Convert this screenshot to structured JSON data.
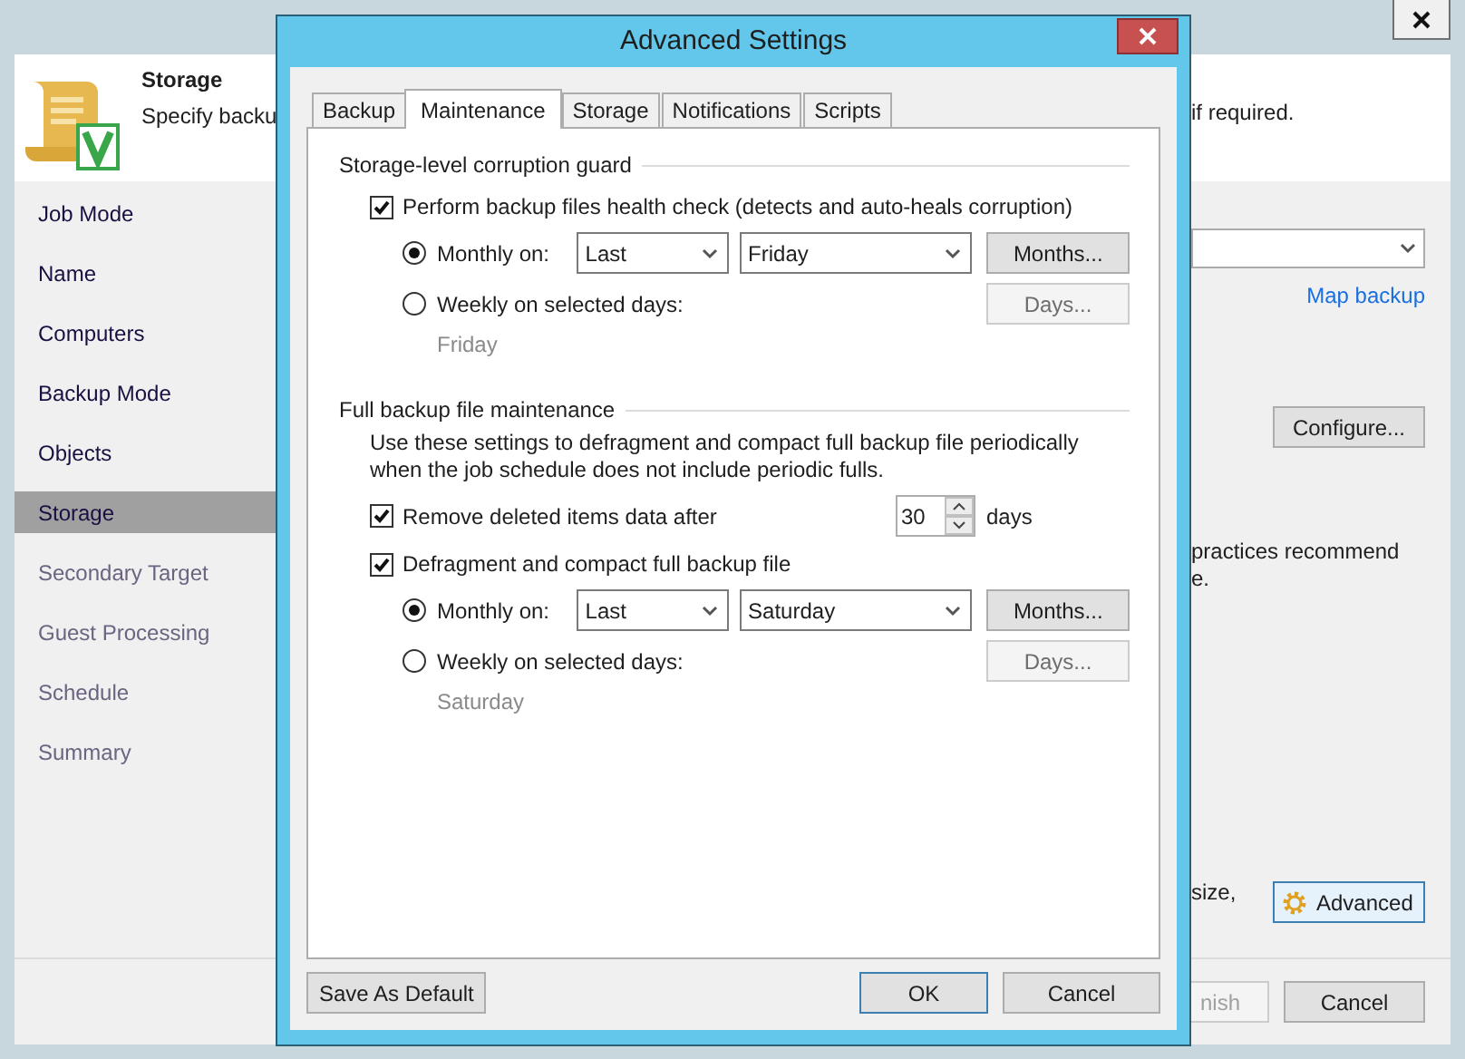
{
  "wizard": {
    "header": {
      "title": "Storage",
      "description_start": "Specify backu",
      "description_end": "if required."
    },
    "steps": [
      {
        "label": "Job Mode",
        "selected": false,
        "disabled": false
      },
      {
        "label": "Name",
        "selected": false,
        "disabled": false
      },
      {
        "label": "Computers",
        "selected": false,
        "disabled": false
      },
      {
        "label": "Backup Mode",
        "selected": false,
        "disabled": false
      },
      {
        "label": "Objects",
        "selected": false,
        "disabled": false
      },
      {
        "label": "Storage",
        "selected": true,
        "disabled": false
      },
      {
        "label": "Secondary Target",
        "selected": false,
        "disabled": true
      },
      {
        "label": "Guest Processing",
        "selected": false,
        "disabled": true
      },
      {
        "label": "Schedule",
        "selected": false,
        "disabled": true
      },
      {
        "label": "Summary",
        "selected": false,
        "disabled": true
      }
    ],
    "content": {
      "map_link": "Map backup",
      "configure_button": "Configure...",
      "note_lines": [
        "practices recommend",
        "e."
      ],
      "size_note": "size,",
      "advanced_button": "Advanced"
    },
    "buttons": [
      {
        "label": "nish",
        "disabled": true
      },
      {
        "label": "Cancel",
        "disabled": false
      }
    ]
  },
  "dialog": {
    "title": "Advanced Settings",
    "tabs": [
      {
        "label": "Backup",
        "selected": false
      },
      {
        "label": "Maintenance",
        "selected": true
      },
      {
        "label": "Storage",
        "selected": false
      },
      {
        "label": "Notifications",
        "selected": false
      },
      {
        "label": "Scripts",
        "selected": false
      }
    ],
    "sections": [
      {
        "title": "Storage-level corruption guard",
        "rows": [
          {
            "kind": "checkbox",
            "label": "Perform backup files health check (detects and auto-heals corruption)",
            "checked": true
          },
          {
            "kind": "monthly",
            "label": "Monthly on:",
            "selected": true,
            "selects": [
              "Last",
              "Friday"
            ],
            "button": {
              "label": "Months...",
              "disabled": false
            }
          },
          {
            "kind": "weekly",
            "label": "Weekly on selected days:",
            "selected": false,
            "button": {
              "label": "Days...",
              "disabled": true
            },
            "summary": "Friday"
          }
        ]
      },
      {
        "title": "Full backup file maintenance",
        "rows": [
          {
            "kind": "text",
            "text": "Use these settings to defragment and compact full backup file periodically\nwhen the job schedule does not include periodic fulls."
          },
          {
            "kind": "spin",
            "label": "Remove deleted items data after",
            "checked": true,
            "value": "30",
            "unit": "days"
          },
          {
            "kind": "checkbox",
            "label": "Defragment and compact full backup file",
            "checked": true
          },
          {
            "kind": "monthly",
            "label": "Monthly on:",
            "selected": true,
            "selects": [
              "Last",
              "Saturday"
            ],
            "button": {
              "label": "Months...",
              "disabled": false
            }
          },
          {
            "kind": "weekly",
            "label": "Weekly on selected days:",
            "selected": false,
            "button": {
              "label": "Days...",
              "disabled": true
            },
            "summary": "Saturday"
          }
        ]
      }
    ],
    "buttons": [
      {
        "label": "Save As Default",
        "kind": "left",
        "default": false
      },
      {
        "label": "OK",
        "kind": "right",
        "default": true
      },
      {
        "label": "Cancel",
        "kind": "right",
        "default": false
      }
    ]
  }
}
